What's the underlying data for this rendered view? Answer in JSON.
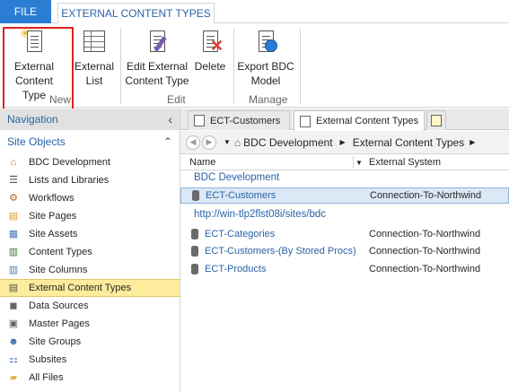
{
  "tabs": {
    "file": "FILE",
    "active": "EXTERNAL CONTENT TYPES"
  },
  "ribbon": {
    "new_group": {
      "label": "New",
      "external_content_type": [
        "External",
        "Content Type"
      ],
      "external_list": [
        "External",
        "List"
      ]
    },
    "edit_group": {
      "label": "Edit",
      "edit_ect": [
        "Edit External",
        "Content Type"
      ],
      "delete": "Delete"
    },
    "manage_group": {
      "label": "Manage",
      "export_bdc": [
        "Export BDC",
        "Model"
      ]
    }
  },
  "nav": {
    "title": "Navigation",
    "collapse_glyph": "‹",
    "section": "Site Objects",
    "section_glyph": "⌃",
    "items": [
      {
        "label": "BDC Development",
        "icon": "home-icon",
        "selected": false
      },
      {
        "label": "Lists and Libraries",
        "icon": "list-icon",
        "selected": false
      },
      {
        "label": "Workflows",
        "icon": "workflow-icon",
        "selected": false
      },
      {
        "label": "Site Pages",
        "icon": "pages-icon",
        "selected": false
      },
      {
        "label": "Site Assets",
        "icon": "assets-icon",
        "selected": false
      },
      {
        "label": "Content Types",
        "icon": "content-types-icon",
        "selected": false
      },
      {
        "label": "Site Columns",
        "icon": "columns-icon",
        "selected": false
      },
      {
        "label": "External Content Types",
        "icon": "ect-icon",
        "selected": true
      },
      {
        "label": "Data Sources",
        "icon": "database-icon",
        "selected": false
      },
      {
        "label": "Master Pages",
        "icon": "master-pages-icon",
        "selected": false
      },
      {
        "label": "Site Groups",
        "icon": "groups-icon",
        "selected": false
      },
      {
        "label": "Subsites",
        "icon": "subsites-icon",
        "selected": false
      },
      {
        "label": "All Files",
        "icon": "folder-icon",
        "selected": false
      }
    ]
  },
  "doc_tabs": [
    {
      "label": "ECT-Customers",
      "active": false
    },
    {
      "label": "External Content Types",
      "active": true
    }
  ],
  "breadcrumb": {
    "site": "BDC Development",
    "page": "External Content Types"
  },
  "table": {
    "headers": {
      "name": "Name",
      "system": "External System"
    },
    "groups": [
      {
        "title": "BDC Development",
        "rows": [
          {
            "name": "ECT-Customers",
            "system": "Connection-To-Northwind",
            "selected": true
          }
        ]
      },
      {
        "title": "http://win-tlp2flst08i/sites/bdc",
        "rows": [
          {
            "name": "ECT-Categories",
            "system": "Connection-To-Northwind",
            "selected": false
          },
          {
            "name": "ECT-Customers-(By Stored Procs)",
            "system": "Connection-To-Northwind",
            "selected": false
          },
          {
            "name": "ECT-Products",
            "system": "Connection-To-Northwind",
            "selected": false
          }
        ]
      }
    ]
  },
  "colors": {
    "accent": "#2b7cd3",
    "selection": "#fcec9b",
    "highlight_box": "#e02020",
    "link": "#2b63a8"
  }
}
